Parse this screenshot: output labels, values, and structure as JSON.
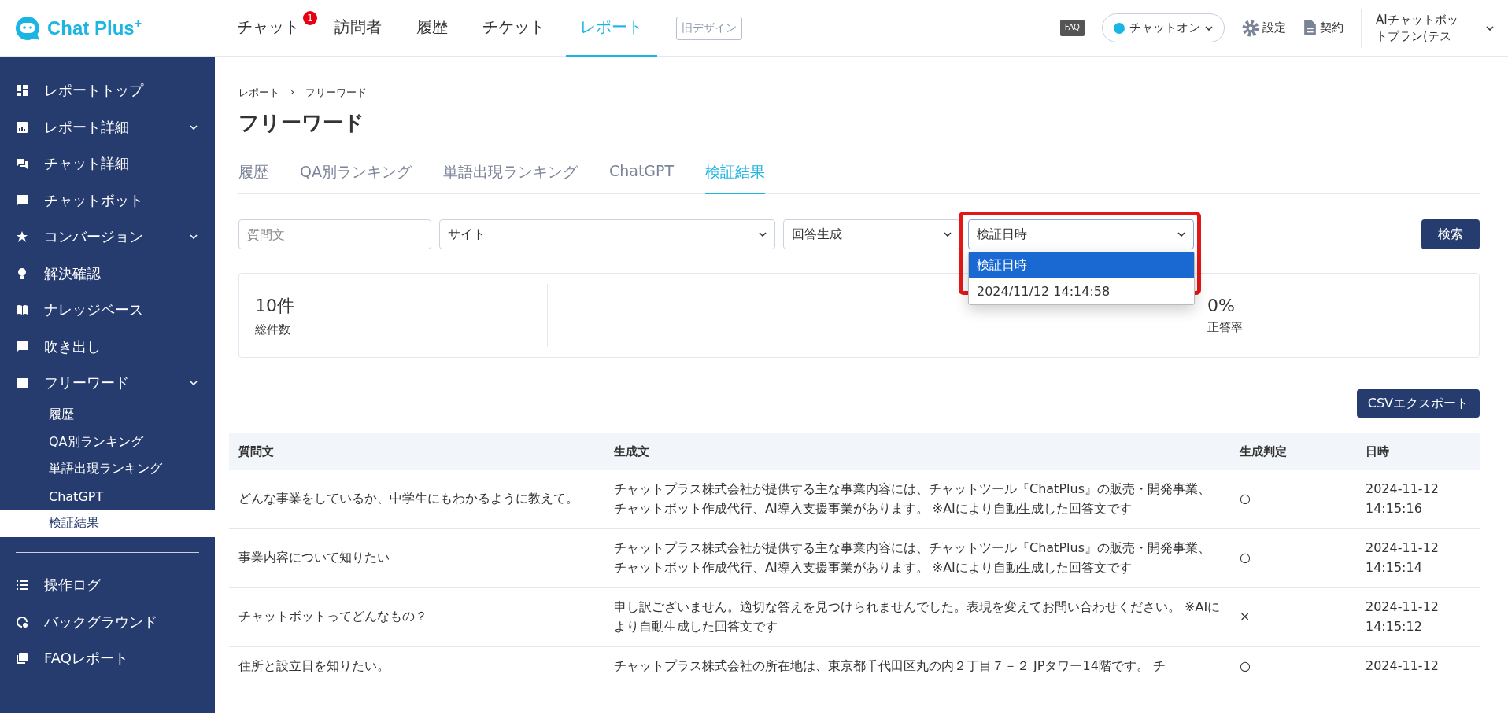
{
  "header": {
    "logo": "Chat Plus$^{+}$",
    "nav": [
      {
        "label": "チャット",
        "selected": false,
        "badge": "1"
      },
      {
        "label": "訪問者",
        "selected": false
      },
      {
        "label": "履歴",
        "selected": false
      },
      {
        "label": "チケット",
        "selected": false
      },
      {
        "label": "レポート",
        "selected": true
      }
    ],
    "old_design": "旧デザイン",
    "faq": "FAQ",
    "status": {
      "label": "チャットオン",
      "on": true
    },
    "settings": "設定",
    "contract": "契約",
    "account": "AIチャットボットプラン(テス"
  },
  "sidebar": {
    "items": [
      {
        "label": "レポートトップ",
        "selected": false,
        "expandable": false
      },
      {
        "label": "レポート詳細",
        "selected": false,
        "expandable": true
      },
      {
        "label": "チャット詳細",
        "selected": false,
        "expandable": false
      },
      {
        "label": "チャットボット",
        "selected": false,
        "expandable": false
      },
      {
        "label": "コンバージョン",
        "selected": false,
        "expandable": true
      },
      {
        "label": "解決確認",
        "selected": false,
        "expandable": false
      },
      {
        "label": "ナレッジベース",
        "selected": false,
        "expandable": false
      },
      {
        "label": "吹き出し",
        "selected": false,
        "expandable": false
      },
      {
        "label": "フリーワード",
        "selected": false,
        "expandable": true,
        "children": [
          {
            "label": "履歴",
            "selected": false
          },
          {
            "label": "QA別ランキング",
            "selected": false
          },
          {
            "label": "単語出現ランキング",
            "selected": false
          },
          {
            "label": "ChatGPT",
            "selected": false
          },
          {
            "label": "検証結果",
            "selected": true
          }
        ]
      }
    ],
    "bottom_items": [
      {
        "label": "操作ログ",
        "selected": false
      },
      {
        "label": "バックグラウンド",
        "selected": false
      },
      {
        "label": "FAQレポート",
        "selected": false
      }
    ]
  },
  "breadcrumb": [
    "レポート",
    "›",
    "フリーワード"
  ],
  "title": "フリーワード",
  "tabs": [
    {
      "label": "履歴",
      "selected": false
    },
    {
      "label": "QA別ランキング",
      "selected": false
    },
    {
      "label": "単語出現ランキング",
      "selected": false
    },
    {
      "label": "ChatGPT",
      "selected": false
    },
    {
      "label": "検証結果",
      "selected": true
    }
  ],
  "filters": {
    "question": {
      "placeholder": "質問文"
    },
    "selects": [
      {
        "value": "サイト",
        "open": false
      },
      {
        "value": "回答生成",
        "open": false
      },
      {
        "value": "検証日時",
        "open": true,
        "highlighted": true,
        "options": [
          {
            "label": "検証日時",
            "selected": true
          },
          {
            "label": "2024/11/12 14:14:58",
            "selected": false
          }
        ]
      }
    ],
    "search_button": "検索"
  },
  "stats": [
    {
      "value": "10件",
      "label": "総件数"
    },
    {
      "value": "0%",
      "label": "正答率"
    }
  ],
  "csv_button": "CSVエクスポート",
  "table": {
    "columns": [
      "質問文",
      "生成文",
      "生成判定",
      "日時"
    ],
    "rows": [
      [
        "どんな事業をしているか、中学生にもわかるように教えて。",
        "チャットプラス株式会社が提供する主な事業内容には、チャットツール『ChatPlus』の販売・開発事業、チャットボット作成代行、AI導入支援事業があります。 ※AIにより自動生成した回答文です",
        "○",
        "2024-11-12 14:15:16"
      ],
      [
        "事業内容について知りたい",
        "チャットプラス株式会社が提供する主な事業内容には、チャットツール『ChatPlus』の販売・開発事業、チャットボット作成代行、AI導入支援事業があります。 ※AIにより自動生成した回答文です",
        "○",
        "2024-11-12 14:15:14"
      ],
      [
        "チャットボットってどんなもの？",
        "申し訳ございません。適切な答えを見つけられませんでした。表現を変えてお問い合わせください。 ※AIにより自動生成した回答文です",
        "×",
        "2024-11-12 14:15:12"
      ],
      [
        "住所と設立日を知りたい。",
        "チャットプラス株式会社の所在地は、東京都千代田区丸の内２丁目７－２ JPタワー14階です。 チ",
        "○",
        "2024-11-12"
      ]
    ]
  }
}
